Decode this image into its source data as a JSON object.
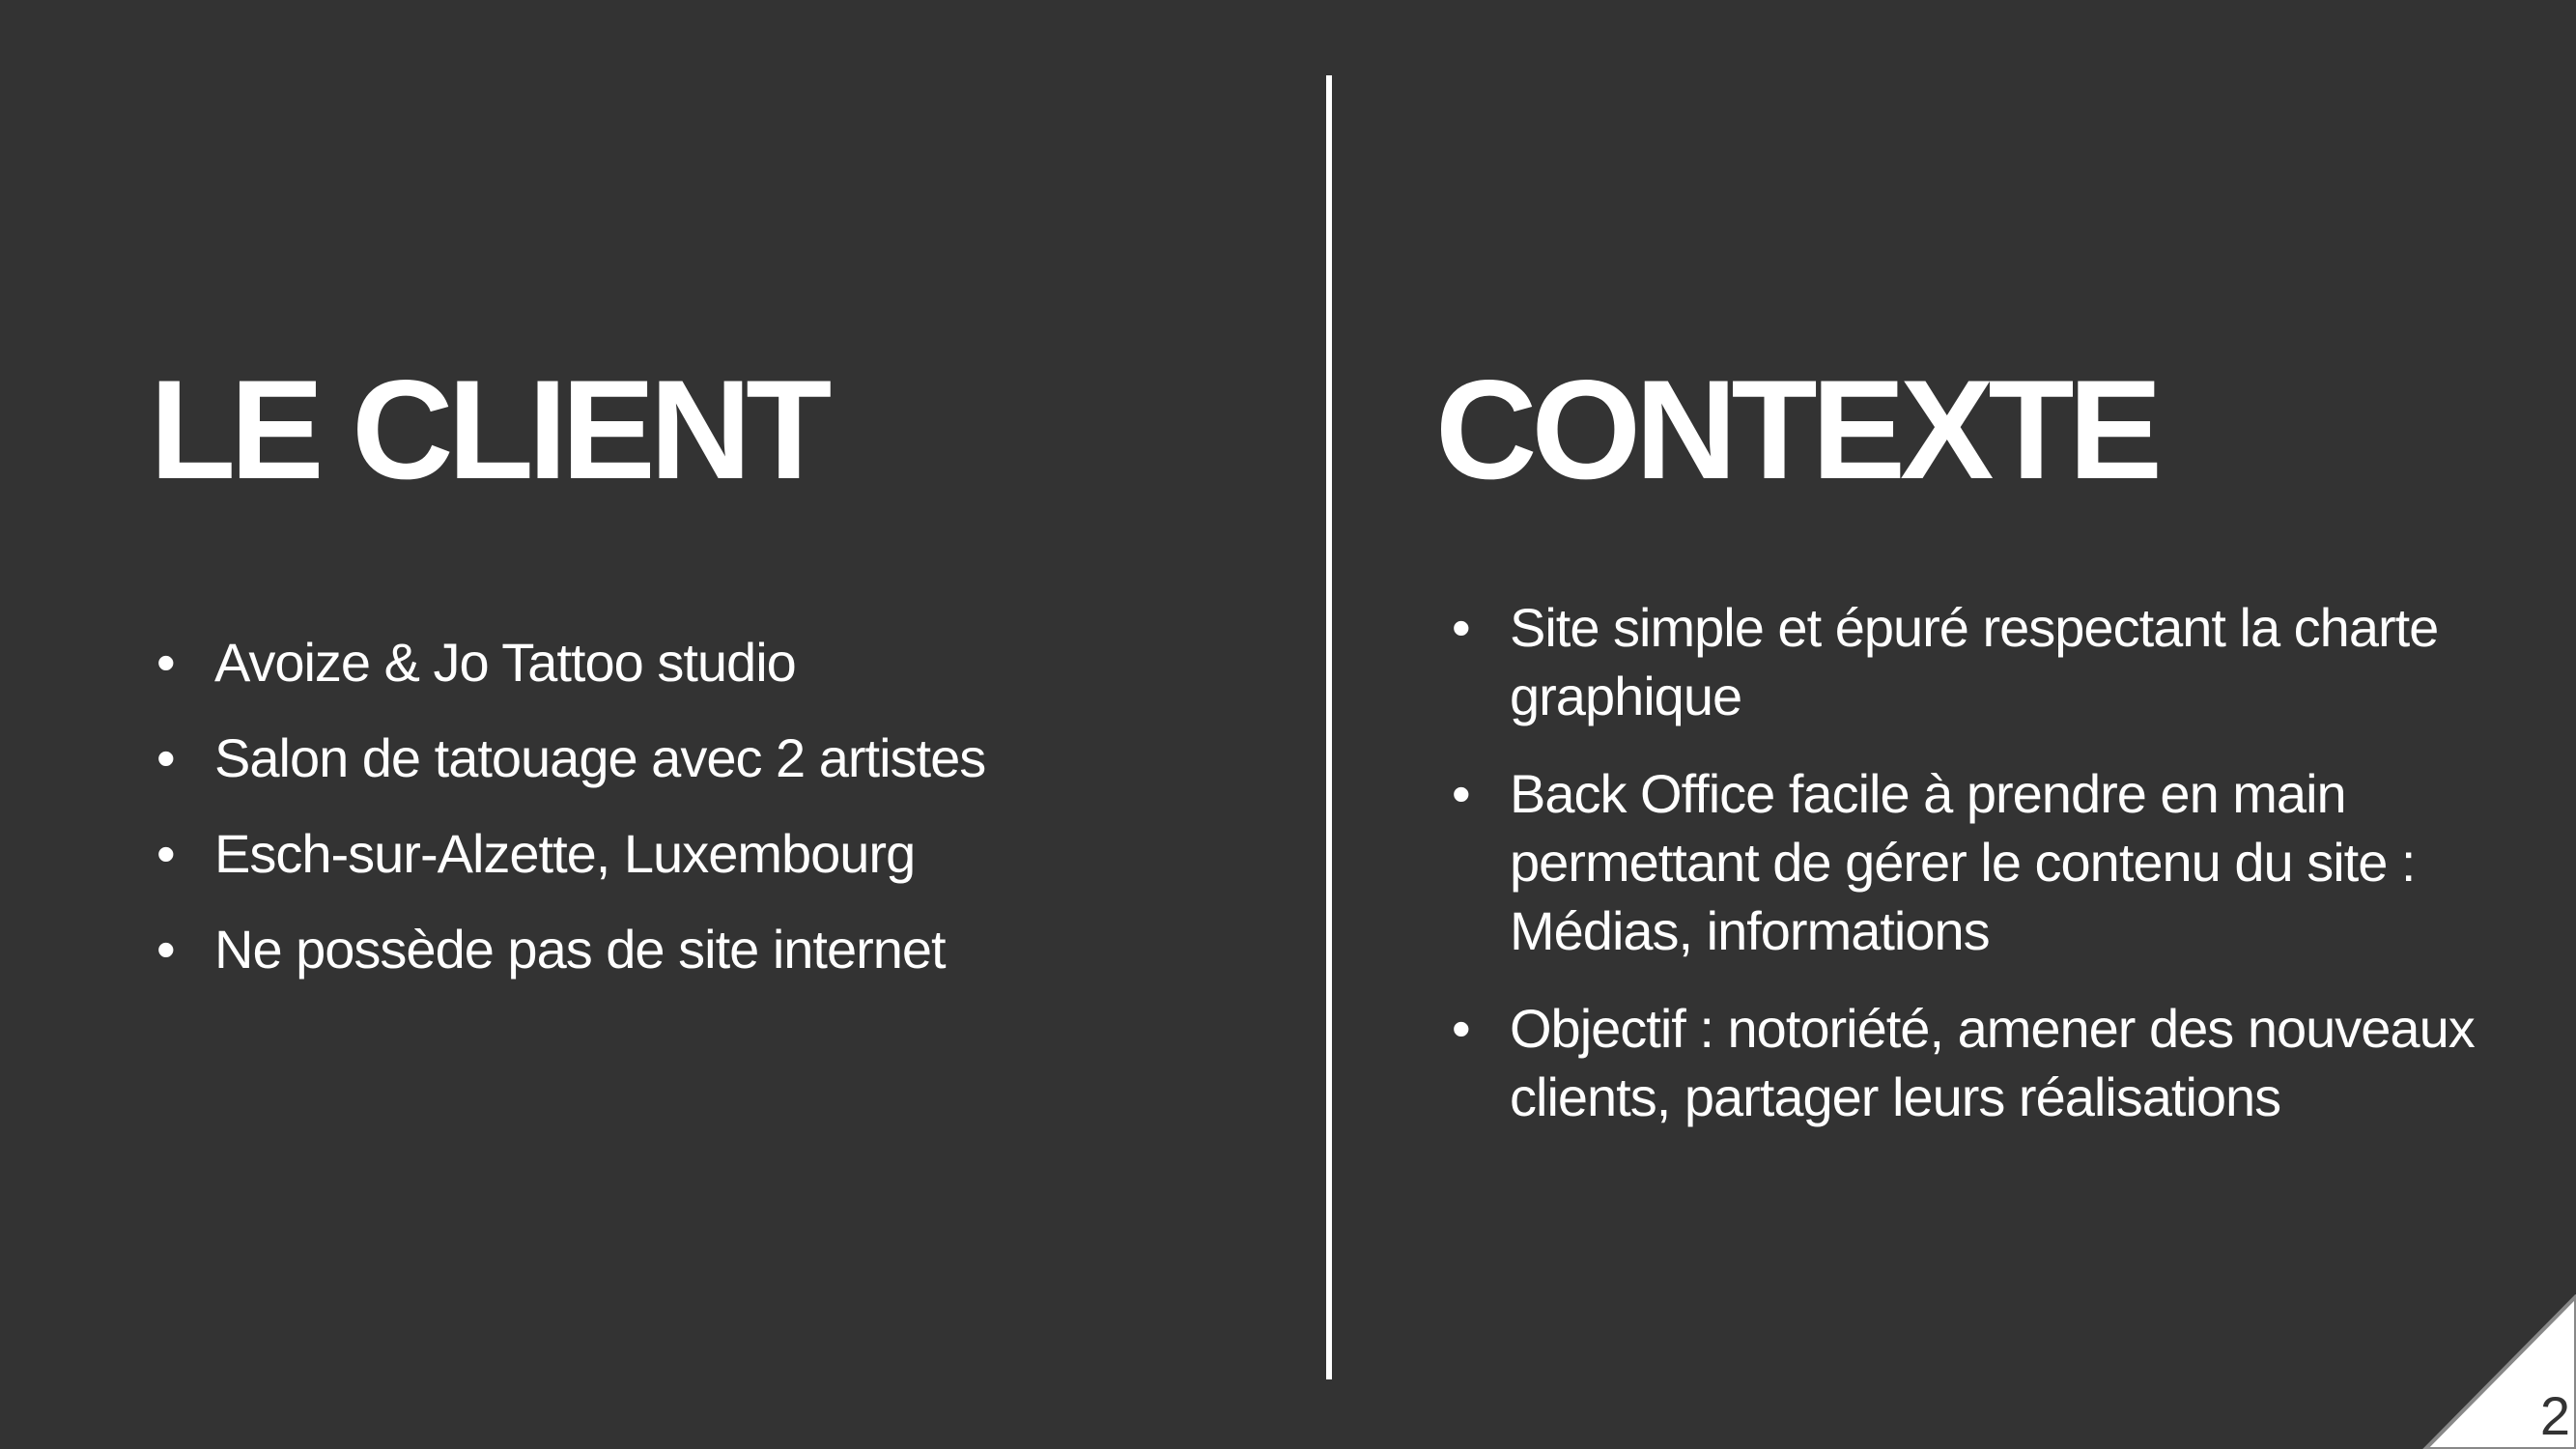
{
  "left": {
    "title": "LE CLIENT",
    "bullets": [
      "Avoize & Jo Tattoo studio",
      "Salon de tatouage avec 2 artistes",
      "Esch-sur-Alzette, Luxembourg",
      "Ne possède pas de site internet"
    ]
  },
  "right": {
    "title": "CONTEXTE",
    "bullets": [
      "Site simple et épuré respectant la charte graphique",
      "Back Office facile à prendre en main permettant de gérer le contenu du site : Médias, informations",
      "Objectif : notoriété, amener des nouveaux clients, partager leurs réalisations"
    ]
  },
  "bullet_char": "•",
  "page_number": "2",
  "colors": {
    "background": "#333333",
    "text": "#ffffff"
  }
}
